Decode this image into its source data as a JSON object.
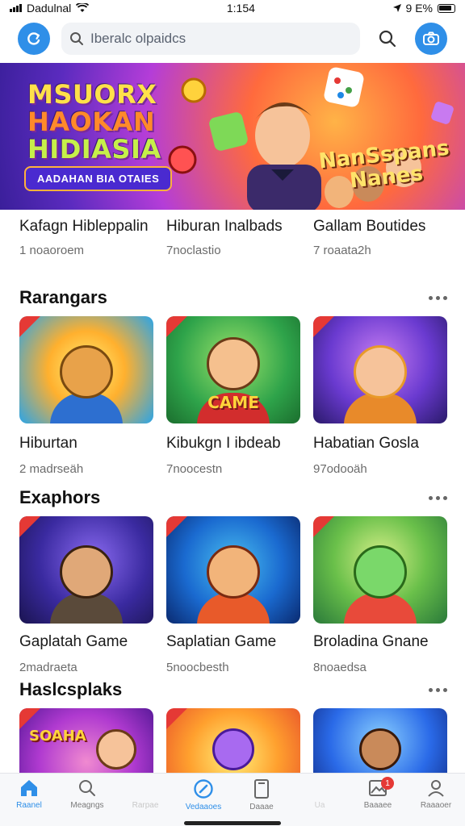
{
  "status": {
    "carrier": "Dadulnal",
    "time": "1:154",
    "battery_text": "9 E%"
  },
  "search": {
    "placeholder": "Iberalc olpaidcs"
  },
  "banner": {
    "title_line1": "MSUORX",
    "title_line2": "HAOKAN",
    "title_line3": "HIDIASIA",
    "pill": "AADAHAN BIA OTAIES",
    "tag_line1": "NanSspans",
    "tag_line2": "Nanes"
  },
  "top_row": [
    {
      "title": "Kafagn Hibleppalin",
      "sub": "1 noaoroem"
    },
    {
      "title": "Hiburan Inalbads",
      "sub": "7noclastio"
    },
    {
      "title": "Gallam Boutides",
      "sub": "7 roaata2h"
    }
  ],
  "sections": [
    {
      "title": "Rarangars",
      "items": [
        {
          "title": "Hiburtan",
          "sub": "2 madrseäh",
          "art": ""
        },
        {
          "title": "Kibukgn I ibdeab",
          "sub": "7noocestn",
          "art": "CAME"
        },
        {
          "title": "Habatian Gosla",
          "sub": "97odooäh",
          "art": ""
        }
      ]
    },
    {
      "title": "Exaphors",
      "items": [
        {
          "title": "Gaplatah Game",
          "sub": "2madraeta",
          "art": ""
        },
        {
          "title": "Saplatian Game",
          "sub": "5noocbesth",
          "art": ""
        },
        {
          "title": "Broladina Gnane",
          "sub": "8noaedsa",
          "art": ""
        }
      ]
    },
    {
      "title": "Haslcsplaks",
      "items": [
        {
          "title": "",
          "sub": "",
          "art": "SOAHA"
        },
        {
          "title": "",
          "sub": "",
          "art": ""
        },
        {
          "title": "",
          "sub": "",
          "art": ""
        }
      ]
    }
  ],
  "nav": [
    {
      "label": "Raanel",
      "icon": "home-icon"
    },
    {
      "label": "Meagngs",
      "icon": "search-icon"
    },
    {
      "label": "Rarpae",
      "icon": ""
    },
    {
      "label": "Vedaaoes",
      "icon": "compass-icon"
    },
    {
      "label": "Daaae",
      "icon": "device-icon"
    },
    {
      "label": "Ua",
      "icon": ""
    },
    {
      "label": "Baaaee",
      "icon": "image-icon",
      "badge": "1"
    },
    {
      "label": "Raaaoer",
      "icon": "profile-icon"
    }
  ]
}
